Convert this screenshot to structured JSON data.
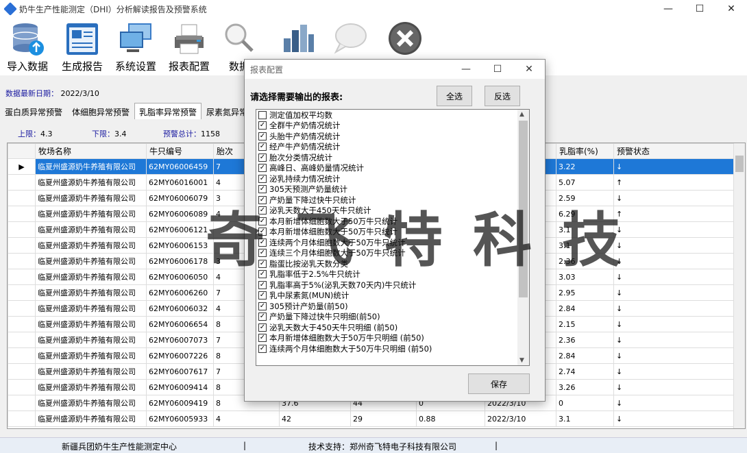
{
  "window": {
    "title": "奶牛生产性能测定（DHI）分析解读报告及预警系统",
    "minimize": "—",
    "maximize": "☐",
    "close": "✕"
  },
  "toolbar": [
    {
      "label": "导入数据",
      "icon": "database-import-icon"
    },
    {
      "label": "生成报告",
      "icon": "report-icon"
    },
    {
      "label": "系统设置",
      "icon": "computer-settings-icon"
    },
    {
      "label": "报表配置",
      "icon": "printer-icon"
    },
    {
      "label": "数据",
      "icon": "magnifier-icon"
    },
    {
      "label": "",
      "icon": "bar-chart-icon"
    },
    {
      "label": "",
      "icon": "speech-bubble-icon"
    },
    {
      "label": "",
      "icon": "exit-icon"
    }
  ],
  "data_date": {
    "label": "数据最新日期：",
    "value": "2022/3/10"
  },
  "tabs": [
    "蛋白质异常预警",
    "体细胞异常预警",
    "乳脂率异常预警",
    "尿素氮异常"
  ],
  "active_tab": 2,
  "limits": {
    "upper_label": "上限：",
    "upper": "4.3",
    "lower_label": "下限：",
    "lower": "3.4",
    "total_label": "预警总计：",
    "total": "1158"
  },
  "grid": {
    "columns": [
      "",
      "牧场名称",
      "牛只编号",
      "胎次",
      "",
      "",
      "",
      "",
      "乳脂率(%)",
      "预警状态"
    ],
    "rows": [
      [
        "▶",
        "临夏州盛源奶牛养殖有限公司",
        "62MY06006459",
        "7",
        "",
        "",
        "",
        "",
        "3.22",
        "↓"
      ],
      [
        "",
        "临夏州盛源奶牛养殖有限公司",
        "62MY06016001",
        "4",
        "",
        "",
        "",
        "",
        "5.07",
        "↑"
      ],
      [
        "",
        "临夏州盛源奶牛养殖有限公司",
        "62MY06006079",
        "3",
        "",
        "",
        "",
        "",
        "2.59",
        "↓"
      ],
      [
        "",
        "临夏州盛源奶牛养殖有限公司",
        "62MY06006089",
        "4",
        "",
        "",
        "",
        "",
        "6.29",
        "↑"
      ],
      [
        "",
        "临夏州盛源奶牛养殖有限公司",
        "62MY06006121",
        "",
        "",
        "",
        "",
        "",
        "3.1",
        "↓"
      ],
      [
        "",
        "临夏州盛源奶牛养殖有限公司",
        "62MY06006153",
        "",
        "",
        "",
        "",
        "",
        "3.1",
        "↓"
      ],
      [
        "",
        "临夏州盛源奶牛养殖有限公司",
        "62MY06006178",
        "3",
        "",
        "",
        "",
        "",
        "2.36",
        "↓"
      ],
      [
        "",
        "临夏州盛源奶牛养殖有限公司",
        "62MY06006050",
        "4",
        "",
        "",
        "",
        "",
        "3.03",
        "↓"
      ],
      [
        "",
        "临夏州盛源奶牛养殖有限公司",
        "62MY06006260",
        "7",
        "",
        "",
        "",
        "",
        "2.95",
        "↓"
      ],
      [
        "",
        "临夏州盛源奶牛养殖有限公司",
        "62MY06006032",
        "4",
        "",
        "",
        "",
        "",
        "2.84",
        "↓"
      ],
      [
        "",
        "临夏州盛源奶牛养殖有限公司",
        "62MY06006654",
        "8",
        "",
        "",
        "",
        "",
        "2.15",
        "↓"
      ],
      [
        "",
        "临夏州盛源奶牛养殖有限公司",
        "62MY06007073",
        "7",
        "",
        "",
        "",
        "",
        "2.36",
        "↓"
      ],
      [
        "",
        "临夏州盛源奶牛养殖有限公司",
        "62MY06007226",
        "8",
        "",
        "",
        "",
        "",
        "2.84",
        "↓"
      ],
      [
        "",
        "临夏州盛源奶牛养殖有限公司",
        "62MY06007617",
        "7",
        "",
        "",
        "",
        "",
        "2.74",
        "↓"
      ],
      [
        "",
        "临夏州盛源奶牛养殖有限公司",
        "62MY06009414",
        "8",
        "",
        "",
        "",
        "",
        "3.26",
        "↓"
      ],
      [
        "",
        "临夏州盛源奶牛养殖有限公司",
        "62MY06009419",
        "8",
        "37.6",
        "44",
        "0",
        "2022/3/10",
        "0",
        "↓"
      ],
      [
        "",
        "临夏州盛源奶牛养殖有限公司",
        "62MY06005933",
        "4",
        "42",
        "29",
        "0.88",
        "2022/3/10",
        "3.1",
        "↓"
      ]
    ]
  },
  "dialog": {
    "title": "报表配置",
    "prompt": "请选择需要输出的报表:",
    "select_all": "全选",
    "invert": "反选",
    "save": "保存",
    "items": [
      {
        "label": "测定值加权平均数",
        "checked": false
      },
      {
        "label": "全群牛产奶情况统计",
        "checked": true
      },
      {
        "label": "头胎牛产奶情况统计",
        "checked": true
      },
      {
        "label": "经产牛产奶情况统计",
        "checked": true
      },
      {
        "label": "胎次分类情况统计",
        "checked": true
      },
      {
        "label": "高峰日、高峰奶量情况统计",
        "checked": true
      },
      {
        "label": "泌乳持续力情况统计",
        "checked": true
      },
      {
        "label": "305天预测产奶量统计",
        "checked": true
      },
      {
        "label": "产奶量下降过快牛只统计",
        "checked": true
      },
      {
        "label": "泌乳天数大于450天牛只统计",
        "checked": true
      },
      {
        "label": "本月新增体细胞数大于50万牛只统计",
        "checked": true
      },
      {
        "label": "本月新增体细胞数大于50万牛只统计",
        "checked": true
      },
      {
        "label": "连续两个月体细胞数大于50万牛只统计",
        "checked": true
      },
      {
        "label": "连续三个月体细胞数大于50万牛只统计",
        "checked": true
      },
      {
        "label": "脂蛋比按泌乳天数分类",
        "checked": true
      },
      {
        "label": "乳脂率低于2.5%牛只统计",
        "checked": true
      },
      {
        "label": "乳脂率高于5%(泌乳天数70天内)牛只统计",
        "checked": true
      },
      {
        "label": "乳中尿素氮(MUN)统计",
        "checked": true
      },
      {
        "label": "305预计产奶量(前50)",
        "checked": true
      },
      {
        "label": "产奶量下降过快牛只明细(前50)",
        "checked": true
      },
      {
        "label": "泌乳天数大于450天牛只明细 (前50)",
        "checked": true
      },
      {
        "label": "本月新增体细胞数大于50万牛只明细 (前50)",
        "checked": true
      },
      {
        "label": "连续两个月体细胞数大于50万牛只明细 (前50)",
        "checked": true
      }
    ]
  },
  "status": {
    "center": "新疆兵团奶牛生产性能测定中心",
    "sep": "|",
    "support": "技术支持：郑州奇飞特电子科技有限公司"
  },
  "watermark": "奇飞特科技"
}
